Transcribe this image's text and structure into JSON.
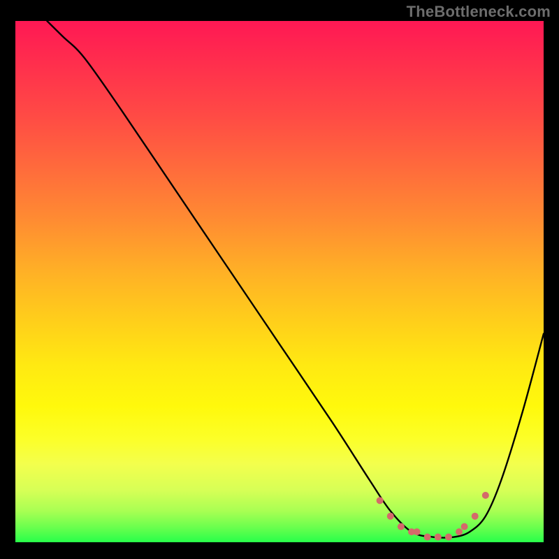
{
  "watermark": "TheBottleneck.com",
  "chart_data": {
    "type": "line",
    "title": "",
    "xlabel": "",
    "ylabel": "",
    "xlim": [
      0,
      100
    ],
    "ylim": [
      0,
      100
    ],
    "grid": false,
    "legend": false,
    "gradient_stops": [
      {
        "pct": 0,
        "color": "#ff1854"
      },
      {
        "pct": 8,
        "color": "#ff2e4d"
      },
      {
        "pct": 18,
        "color": "#ff4a45"
      },
      {
        "pct": 28,
        "color": "#ff6a3c"
      },
      {
        "pct": 38,
        "color": "#ff8b32"
      },
      {
        "pct": 48,
        "color": "#ffb026"
      },
      {
        "pct": 58,
        "color": "#ffd01a"
      },
      {
        "pct": 66,
        "color": "#ffe912"
      },
      {
        "pct": 74,
        "color": "#fff90c"
      },
      {
        "pct": 80,
        "color": "#fcff27"
      },
      {
        "pct": 85,
        "color": "#f3ff4d"
      },
      {
        "pct": 90,
        "color": "#d7ff56"
      },
      {
        "pct": 94,
        "color": "#a9ff53"
      },
      {
        "pct": 97,
        "color": "#6dff4e"
      },
      {
        "pct": 100,
        "color": "#28ff4a"
      }
    ],
    "series": [
      {
        "name": "bottleneck-curve",
        "color": "#000000",
        "x": [
          6,
          9,
          13,
          20,
          30,
          40,
          50,
          60,
          67,
          71,
          75,
          79,
          83,
          86,
          89,
          92,
          96,
          100
        ],
        "y": [
          100,
          97,
          93,
          83,
          68,
          53,
          38,
          23,
          12,
          6,
          2,
          1,
          1,
          2,
          5,
          12,
          25,
          40
        ]
      }
    ],
    "markers": {
      "name": "min-region-dots",
      "color": "#d46a6a",
      "radius": 5,
      "points": [
        {
          "x": 69,
          "y": 8
        },
        {
          "x": 71,
          "y": 5
        },
        {
          "x": 73,
          "y": 3
        },
        {
          "x": 75,
          "y": 2
        },
        {
          "x": 76,
          "y": 2
        },
        {
          "x": 78,
          "y": 1
        },
        {
          "x": 80,
          "y": 1
        },
        {
          "x": 82,
          "y": 1
        },
        {
          "x": 84,
          "y": 2
        },
        {
          "x": 85,
          "y": 3
        },
        {
          "x": 87,
          "y": 5
        },
        {
          "x": 89,
          "y": 9
        }
      ]
    }
  }
}
